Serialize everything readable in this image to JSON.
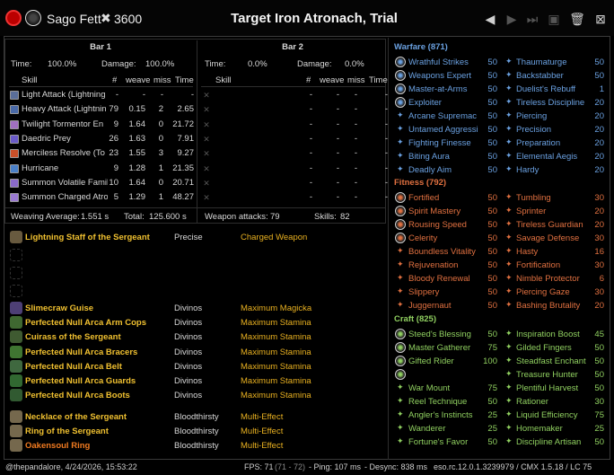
{
  "header": {
    "player_name": "Sago Fett",
    "cp_points": "3600",
    "title": "Target Iron Atronach, Trial"
  },
  "bar1": {
    "heading": "Bar 1",
    "time_label": "Time:",
    "time_value": "100.0%",
    "damage_label": "Damage:",
    "damage_value": "100.0%",
    "col_skill": "Skill",
    "col_count": "#",
    "col_weave": "weave",
    "col_miss": "miss",
    "col_time": "Time",
    "rows": [
      {
        "skill": "Light Attack (Lightning",
        "count": "-",
        "weave": "-",
        "miss": "-",
        "time": "-",
        "color": "#5a6e9a"
      },
      {
        "skill": "Heavy Attack (Lightnin",
        "count": "79",
        "weave": "0.15",
        "miss": "2",
        "time": "2.65",
        "color": "#4a6aa8"
      },
      {
        "skill": "Twilight Tormentor En",
        "count": "9",
        "weave": "1.64",
        "miss": "0",
        "time": "21.72",
        "color": "#a070c0"
      },
      {
        "skill": "Daedric Prey",
        "count": "26",
        "weave": "1.63",
        "miss": "0",
        "time": "7.91",
        "color": "#6a5ac8"
      },
      {
        "skill": "Merciless Resolve (To",
        "count": "23",
        "weave": "1.55",
        "miss": "3",
        "time": "9.27",
        "color": "#c8502a"
      },
      {
        "skill": "Hurricane",
        "count": "9",
        "weave": "1.28",
        "miss": "1",
        "time": "21.35",
        "color": "#4a80c8"
      },
      {
        "skill": "Summon Volatile Famil",
        "count": "10",
        "weave": "1.64",
        "miss": "0",
        "time": "20.71",
        "color": "#8a6ac8"
      },
      {
        "skill": "Summon Charged Atro",
        "count": "5",
        "weave": "1.29",
        "miss": "1",
        "time": "48.27",
        "color": "#9a7ad0"
      }
    ],
    "weaving_label": "Weaving Average:",
    "weaving_value": "1.551 s",
    "total_label": "Total:",
    "total_value": "125.600 s"
  },
  "bar2": {
    "heading": "Bar 2",
    "time_label": "Time:",
    "time_value": "0.0%",
    "damage_label": "Damage:",
    "damage_value": "0.0%",
    "col_skill": "Skill",
    "col_count": "#",
    "col_weave": "weave",
    "col_miss": "miss",
    "col_time": "Time",
    "rows": [
      {
        "count": "-",
        "weave": "-",
        "miss": "-",
        "time": "-"
      },
      {
        "count": "-",
        "weave": "-",
        "miss": "-",
        "time": "-"
      },
      {
        "count": "-",
        "weave": "-",
        "miss": "-",
        "time": "-"
      },
      {
        "count": "-",
        "weave": "-",
        "miss": "-",
        "time": "-"
      },
      {
        "count": "-",
        "weave": "-",
        "miss": "-",
        "time": "-"
      },
      {
        "count": "-",
        "weave": "-",
        "miss": "-",
        "time": "-"
      },
      {
        "count": "-",
        "weave": "-",
        "miss": "-",
        "time": "-"
      },
      {
        "count": "-",
        "weave": "-",
        "miss": "-",
        "time": "-"
      }
    ],
    "weapon_attacks_label": "Weapon attacks:",
    "weapon_attacks_value": "79",
    "skills_label": "Skills:",
    "skills_value": "82"
  },
  "gear": {
    "weapon": {
      "name": "Lightning Staff of the Sergeant",
      "trait": "Precise",
      "enchant": "Charged Weapon"
    },
    "armor": [
      {
        "name": "Slimecraw Guise",
        "trait": "Divinos",
        "enchant": "Maximum Magicka",
        "color": "gold"
      },
      {
        "name": "Perfected Null Arca Arm Cops",
        "trait": "Divinos",
        "enchant": "Maximum Stamina",
        "color": "gold"
      },
      {
        "name": "Cuirass of the Sergeant",
        "trait": "Divinos",
        "enchant": "Maximum Stamina",
        "color": "gold"
      },
      {
        "name": "Perfected Null Arca Bracers",
        "trait": "Divinos",
        "enchant": "Maximum Stamina",
        "color": "gold"
      },
      {
        "name": "Perfected Null Arca Belt",
        "trait": "Divinos",
        "enchant": "Maximum Stamina",
        "color": "gold"
      },
      {
        "name": "Perfected Null Arca Guards",
        "trait": "Divinos",
        "enchant": "Maximum Stamina",
        "color": "gold"
      },
      {
        "name": "Perfected Null Arca Boots",
        "trait": "Divinos",
        "enchant": "Maximum Stamina",
        "color": "gold"
      }
    ],
    "jewelry": [
      {
        "name": "Necklace of the Sergeant",
        "trait": "Bloodthirsty",
        "enchant": "Multi-Effect",
        "color": "gold"
      },
      {
        "name": "Ring of the Sergeant",
        "trait": "Bloodthirsty",
        "enchant": "Multi-Effect",
        "color": "gold"
      },
      {
        "name": "Oakensoul Ring",
        "trait": "Bloodthirsty",
        "enchant": "Multi-Effect",
        "color": "orange"
      }
    ]
  },
  "cp": {
    "warfare": {
      "heading": "Warfare (871)",
      "color": "#6aa0e0",
      "left": [
        {
          "name": "Wrathful Strikes",
          "value": "50",
          "slotted": true
        },
        {
          "name": "Weapons Expert",
          "value": "50",
          "slotted": true
        },
        {
          "name": "Master-at-Arms",
          "value": "50",
          "slotted": true
        },
        {
          "name": "Exploiter",
          "value": "50",
          "slotted": true
        },
        {
          "name": "Arcane Supremac",
          "value": "50",
          "slotted": false
        },
        {
          "name": "Untamed Aggressi",
          "value": "50",
          "slotted": false
        },
        {
          "name": "Fighting Finesse",
          "value": "50",
          "slotted": false
        },
        {
          "name": "Biting Aura",
          "value": "50",
          "slotted": false
        },
        {
          "name": "Deadly Aim",
          "value": "50",
          "slotted": false
        }
      ],
      "right": [
        {
          "name": "Thaumaturge",
          "value": "50"
        },
        {
          "name": "Backstabber",
          "value": "50"
        },
        {
          "name": "Duelist's Rebuff",
          "value": "1"
        },
        {
          "name": "Tireless Discipline",
          "value": "20"
        },
        {
          "name": "Piercing",
          "value": "20"
        },
        {
          "name": "Precision",
          "value": "20"
        },
        {
          "name": "Preparation",
          "value": "20"
        },
        {
          "name": "Elemental Aegis",
          "value": "20"
        },
        {
          "name": "Hardy",
          "value": "20"
        }
      ]
    },
    "fitness": {
      "heading": "Fitness (792)",
      "color": "#e07040",
      "left": [
        {
          "name": "Fortified",
          "value": "50",
          "slotted": true
        },
        {
          "name": "Spirit Mastery",
          "value": "50",
          "slotted": true
        },
        {
          "name": "Rousing Speed",
          "value": "50",
          "slotted": true
        },
        {
          "name": "Celerity",
          "value": "50",
          "slotted": true
        },
        {
          "name": "Boundless Vitality",
          "value": "50",
          "slotted": false
        },
        {
          "name": "Rejuvenation",
          "value": "50",
          "slotted": false
        },
        {
          "name": "Bloody Renewal",
          "value": "50",
          "slotted": false
        },
        {
          "name": "Slippery",
          "value": "50",
          "slotted": false
        },
        {
          "name": "Juggernaut",
          "value": "50",
          "slotted": false
        }
      ],
      "right": [
        {
          "name": "Tumbling",
          "value": "30"
        },
        {
          "name": "Sprinter",
          "value": "20"
        },
        {
          "name": "Tireless Guardian",
          "value": "20"
        },
        {
          "name": "Savage Defense",
          "value": "30"
        },
        {
          "name": "Hasty",
          "value": "16"
        },
        {
          "name": "Fortification",
          "value": "30"
        },
        {
          "name": "Nimble Protector",
          "value": "6"
        },
        {
          "name": "Piercing Gaze",
          "value": "30"
        },
        {
          "name": "Bashing Brutality",
          "value": "20"
        }
      ]
    },
    "craft": {
      "heading": "Craft (825)",
      "color": "#90d060",
      "left": [
        {
          "name": "Steed's Blessing",
          "value": "50",
          "slotted": true
        },
        {
          "name": "Master Gatherer",
          "value": "75",
          "slotted": true
        },
        {
          "name": "Gifted Rider",
          "value": "100",
          "slotted": true
        },
        {
          "name": "",
          "value": "",
          "slotted": true
        },
        {
          "name": "War Mount",
          "value": "75",
          "slotted": false
        },
        {
          "name": "Reel Technique",
          "value": "50",
          "slotted": false
        },
        {
          "name": "Angler's Instincts",
          "value": "25",
          "slotted": false
        },
        {
          "name": "Wanderer",
          "value": "25",
          "slotted": false
        },
        {
          "name": "Fortune's Favor",
          "value": "50",
          "slotted": false
        }
      ],
      "right": [
        {
          "name": "Inspiration Boost",
          "value": "45"
        },
        {
          "name": "Gilded Fingers",
          "value": "50"
        },
        {
          "name": "Steadfast Enchant",
          "value": "50"
        },
        {
          "name": "Treasure Hunter",
          "value": "50"
        },
        {
          "name": "Plentiful Harvest",
          "value": "50"
        },
        {
          "name": "Rationer",
          "value": "30"
        },
        {
          "name": "Liquid Efficiency",
          "value": "75"
        },
        {
          "name": "Homemaker",
          "value": "25"
        },
        {
          "name": "Discipline Artisan",
          "value": "50"
        }
      ]
    }
  },
  "footer": {
    "user_date": "@thepandalore, 4/24/2026, 15:53:22",
    "fps_label": "FPS: 71",
    "fps_range": "(71 - 72)",
    "ping": "- Ping: 107 ms",
    "desync": "- Desync: 838 ms",
    "version": "eso.rc.12.0.1.3239979 / CMX 1.5.18 / LC 75"
  }
}
